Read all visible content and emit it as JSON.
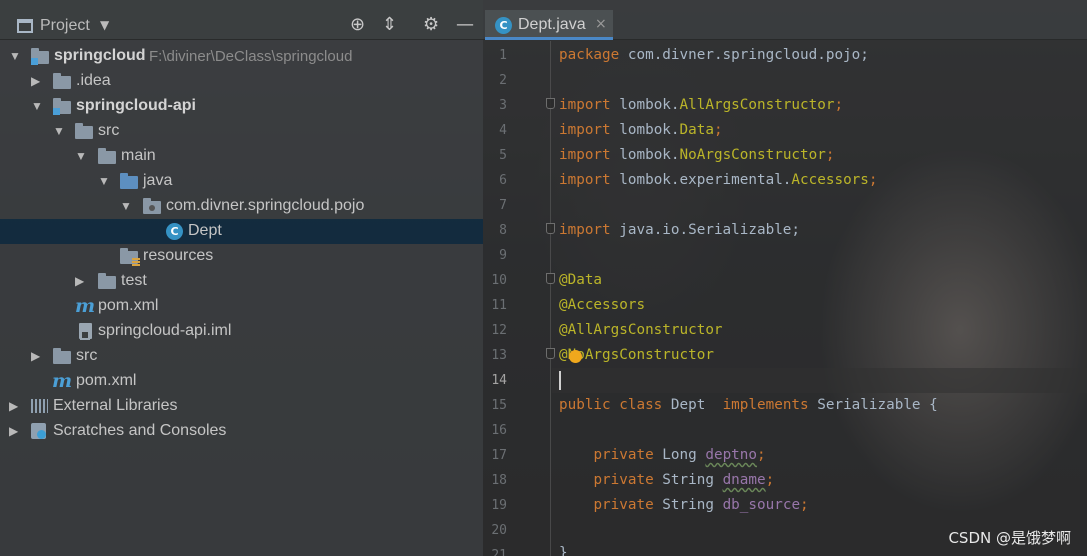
{
  "project_panel": {
    "title": "Project",
    "toolbar_icons": [
      "crosshair-icon",
      "collapse-all-icon",
      "gear-icon",
      "minimize-icon"
    ],
    "tree": [
      {
        "label": "springcloud",
        "path": "F:\\diviner\\DeClass\\springcloud",
        "icon": "module-folder-icon",
        "expanded": true,
        "bold": true
      },
      {
        "label": ".idea",
        "icon": "folder-icon",
        "expanded": false
      },
      {
        "label": "springcloud-api",
        "icon": "module-folder-icon",
        "expanded": true,
        "bold": true
      },
      {
        "label": "src",
        "icon": "folder-icon",
        "expanded": true
      },
      {
        "label": "main",
        "icon": "folder-icon",
        "expanded": true
      },
      {
        "label": "java",
        "icon": "source-folder-icon",
        "expanded": true
      },
      {
        "label": "com.divner.springcloud.pojo",
        "icon": "package-icon",
        "expanded": true
      },
      {
        "label": "Dept",
        "icon": "class-icon",
        "selected": true
      },
      {
        "label": "resources",
        "icon": "resources-folder-icon"
      },
      {
        "label": "test",
        "icon": "folder-icon",
        "expanded": false
      },
      {
        "label": "pom.xml",
        "icon": "maven-icon"
      },
      {
        "label": "springcloud-api.iml",
        "icon": "iml-file-icon"
      },
      {
        "label": "src",
        "icon": "folder-icon",
        "expanded": false
      },
      {
        "label": "pom.xml",
        "icon": "maven-icon"
      },
      {
        "label": "External Libraries",
        "icon": "libraries-icon",
        "expanded": false
      },
      {
        "label": "Scratches and Consoles",
        "icon": "scratches-icon",
        "expanded": false
      }
    ]
  },
  "editor": {
    "tab": {
      "label": "Dept.java",
      "close": "×",
      "icon_letter": "C"
    },
    "class_icon_letter": "C",
    "current_line": 14,
    "line_numbers": [
      "1",
      "2",
      "3",
      "4",
      "5",
      "6",
      "7",
      "8",
      "9",
      "10",
      "11",
      "12",
      "13",
      "14",
      "15",
      "16",
      "17",
      "18",
      "19",
      "20",
      "21"
    ],
    "code": {
      "l1_kw": "package",
      "l1_rest": " com.divner.springcloud.pojo;",
      "l3_kw": "import",
      "l3_pkg": " lombok.",
      "l3_cls": "AllArgsConstructor",
      "l3_end": ";",
      "l4_kw": "import",
      "l4_pkg": " lombok.",
      "l4_cls": "Data",
      "l4_end": ";",
      "l5_kw": "import",
      "l5_pkg": " lombok.",
      "l5_cls": "NoArgsConstructor",
      "l5_end": ";",
      "l6_kw": "import",
      "l6_pkg": " lombok.experimental.",
      "l6_cls": "Accessors",
      "l6_end": ";",
      "l8_kw": "import",
      "l8_rest": " java.io.Serializable;",
      "l10": "@Data",
      "l11": "@Accessors",
      "l12": "@AllArgsConstructor",
      "l13": "@NoArgsConstructor",
      "l15_kw1": "public class",
      "l15_name": " Dept  ",
      "l15_kw2": "implements",
      "l15_rest": " Serializable {",
      "l17_kw": "private",
      "l17_type": " Long ",
      "l17_field": "deptno",
      "l17_end": ";",
      "l18_kw": "private",
      "l18_type": " String ",
      "l18_field": "dname",
      "l18_end": ";",
      "l19_kw": "private",
      "l19_type": " String ",
      "l19_field": "db_source",
      "l19_end": ";",
      "l21": "}"
    }
  },
  "watermark": "CSDN @是饿梦啊",
  "colors": {
    "keyword": "#cc7832",
    "annotation": "#bbb529",
    "field": "#9876aa",
    "text": "#a9b7c6",
    "selection": "#0d293e"
  }
}
